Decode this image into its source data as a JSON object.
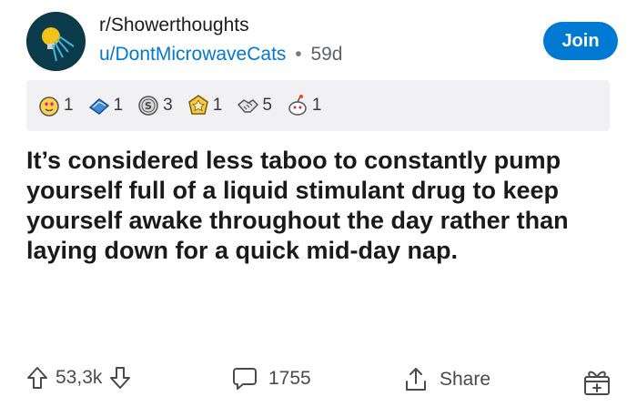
{
  "post": {
    "subreddit": "r/Showerthoughts",
    "username": "u/DontMicrowaveCats",
    "separator": "•",
    "age": "59d",
    "join_label": "Join",
    "title": "It’s considered less taboo to constantly pump yourself full of a liquid stimulant drug to keep yourself awake throughout the day rather than laying down for a quick mid-day nap."
  },
  "awards": [
    {
      "icon": "heart-eyes-award-icon",
      "count": "1"
    },
    {
      "icon": "book-award-icon",
      "count": "1"
    },
    {
      "icon": "silver-coin-award-icon",
      "count": "3"
    },
    {
      "icon": "gold-star-award-icon",
      "count": "1"
    },
    {
      "icon": "handshake-award-icon",
      "count": "5"
    },
    {
      "icon": "snoo-award-icon",
      "count": "1"
    }
  ],
  "actions": {
    "score": "53,3k",
    "comments": "1755",
    "share_label": "Share"
  },
  "colors": {
    "accent": "#0079d3",
    "avatar_bg": "#0b3a4a",
    "awards_bg": "#f1f1f3"
  }
}
